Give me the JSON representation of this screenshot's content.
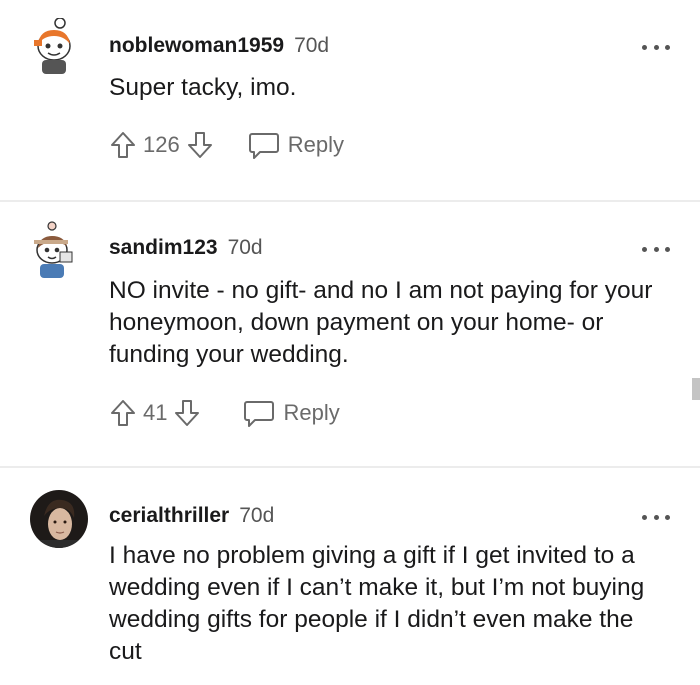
{
  "comments": [
    {
      "username": "noblewoman1959",
      "age": "70d",
      "text": "Super tacky, imo.",
      "score": "126",
      "reply_label": "Reply",
      "avatar_icon": "snoo-avatar-icon"
    },
    {
      "username": "sandim123",
      "age": "70d",
      "text": "NO invite - no gift- and no I am not paying for your honeymoon, down payment on your home- or funding your wedding.",
      "score": "41",
      "reply_label": "Reply",
      "avatar_icon": "snoo-avatar-icon"
    },
    {
      "username": "cerialthriller",
      "age": "70d",
      "text": "I have no problem giving a gift if I get invited to a wedding even if I can’t make it, but I’m not buying wedding gifts for people if I didn’t even make the cut",
      "avatar_icon": "profile-photo-avatar"
    }
  ],
  "colors": {
    "text": "#1a1a1b",
    "muted": "#6a6a6a",
    "divider": "#ececec"
  }
}
